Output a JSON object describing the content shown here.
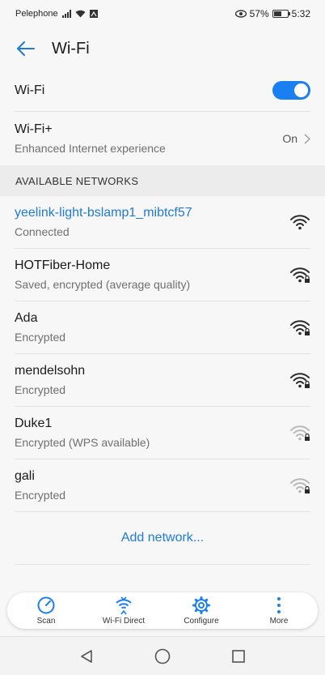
{
  "status_bar": {
    "carrier": "Pelephone",
    "battery": "57%",
    "time": "5:32"
  },
  "app_bar": {
    "title": "Wi-Fi",
    "back_icon": "arrow-left-icon"
  },
  "wifi_toggle": {
    "label": "Wi-Fi",
    "state": "on"
  },
  "wifi_plus": {
    "title": "Wi-Fi+",
    "subtitle": "Enhanced Internet experience",
    "value": "On"
  },
  "section_header": "AVAILABLE NETWORKS",
  "networks": [
    {
      "name": "yeelink-light-bslamp1_mibtcf57",
      "status": "Connected",
      "strength": "full",
      "locked": false
    },
    {
      "name": "HOTFiber-Home",
      "status": "Saved, encrypted (average quality)",
      "strength": "full",
      "locked": true
    },
    {
      "name": "Ada",
      "status": "Encrypted",
      "strength": "full",
      "locked": true
    },
    {
      "name": "mendelsohn",
      "status": "Encrypted",
      "strength": "full",
      "locked": true
    },
    {
      "name": "Duke1",
      "status": "Encrypted (WPS available)",
      "strength": "weak",
      "locked": true
    },
    {
      "name": "gali",
      "status": "Encrypted",
      "strength": "weak",
      "locked": true
    }
  ],
  "add_network": "Add network...",
  "bottom_bar": {
    "items": [
      {
        "label": "Scan",
        "icon": "scan-icon"
      },
      {
        "label": "Wi-Fi Direct",
        "icon": "wifi-direct-icon"
      },
      {
        "label": "Configure",
        "icon": "gear-icon"
      },
      {
        "label": "More",
        "icon": "more-vertical-icon"
      }
    ]
  },
  "colors": {
    "accent": "#1a7ff0",
    "link": "#1f7bd4"
  }
}
